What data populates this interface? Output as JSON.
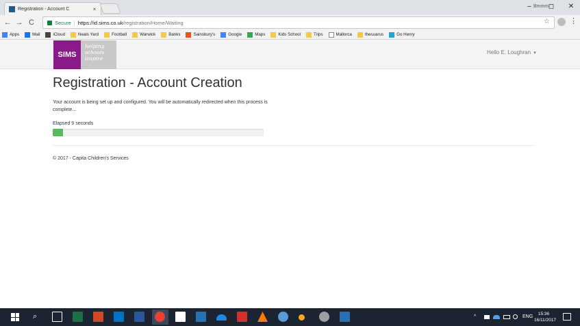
{
  "browser": {
    "tab_title": "Registration - Account C",
    "tab_close": "×",
    "window_user": "Bmmm",
    "minimize": "–",
    "maximize": "◻",
    "close": "✕",
    "back": "←",
    "forward": "→",
    "reload": "C",
    "secure_label": "Secure",
    "url_separator": "|",
    "url_host": "https://id.sims.co.uk",
    "url_path": "/registration/Home/Waiting",
    "star": "☆",
    "menu": "⋮"
  },
  "bookmarks": [
    {
      "label": "Apps",
      "color": "#4285f4"
    },
    {
      "label": "Mail",
      "color": "#1a73e8"
    },
    {
      "label": "iCloud",
      "color": "#444444"
    },
    {
      "label": "Neals Yard",
      "color": "#f6c94b"
    },
    {
      "label": "Football",
      "color": "#f6c94b"
    },
    {
      "label": "Warwick",
      "color": "#f6c94b"
    },
    {
      "label": "Banks",
      "color": "#f6c94b"
    },
    {
      "label": "Sainsbury's",
      "color": "#e8551a"
    },
    {
      "label": "Google",
      "color": "#4285f4"
    },
    {
      "label": "Maps",
      "color": "#34a853"
    },
    {
      "label": "Kids School",
      "color": "#f6c94b"
    },
    {
      "label": "Trips",
      "color": "#f6c94b"
    },
    {
      "label": "Mallorca",
      "color": "#ffffff"
    },
    {
      "label": "thesuarus",
      "color": "#f6c94b"
    },
    {
      "label": "Go Henry",
      "color": "#29a3d6"
    }
  ],
  "header": {
    "logo_text": "SIMS",
    "tagline": [
      "helping",
      "schools",
      "inspire"
    ],
    "user_greeting": "Hello E. Loughran",
    "user_caret": "▾",
    "brand_color": "#8b1a89"
  },
  "main": {
    "title": "Registration - Account Creation",
    "message": "Your account is being set up and configured. You will be automatically redirected when this process is complete...",
    "elapsed_prefix": "Elapsed",
    "elapsed_value": "9",
    "elapsed_suffix": "seconds",
    "progress_percent": 5,
    "progress_color": "#5cb85c"
  },
  "footer": {
    "text": "© 2017 - Capita Children's Services"
  },
  "taskbar": {
    "search_glyph": "⌕",
    "tray_caret": "^",
    "language": "ENG",
    "time": "15:36",
    "date": "16/11/2017"
  }
}
